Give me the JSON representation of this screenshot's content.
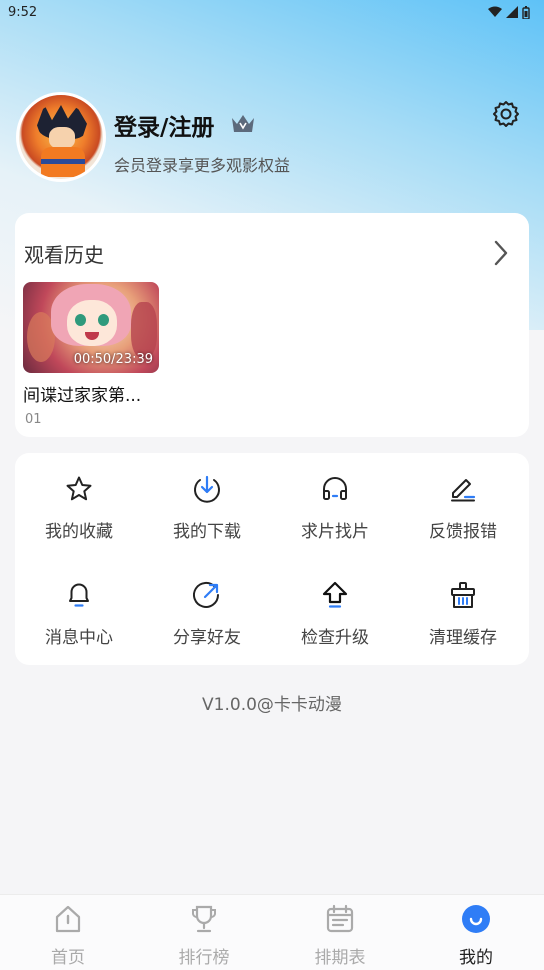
{
  "status_bar": {
    "time": "9:52"
  },
  "profile": {
    "login_label": "登录/注册",
    "subtitle": "会员登录享更多观影权益"
  },
  "history": {
    "title": "观看历史",
    "items": [
      {
        "title": "间谍过家家第...",
        "episode": "01",
        "progress_time": "00:50/23:39"
      }
    ]
  },
  "features": [
    {
      "label": "我的收藏",
      "icon": "star-icon"
    },
    {
      "label": "我的下载",
      "icon": "download-icon"
    },
    {
      "label": "求片找片",
      "icon": "headphones-icon"
    },
    {
      "label": "反馈报错",
      "icon": "edit-icon"
    },
    {
      "label": "消息中心",
      "icon": "bell-icon"
    },
    {
      "label": "分享好友",
      "icon": "share-icon"
    },
    {
      "label": "检查升级",
      "icon": "upgrade-icon"
    },
    {
      "label": "清理缓存",
      "icon": "clean-icon"
    }
  ],
  "version": "V1.0.0@卡卡动漫",
  "tabs": [
    {
      "label": "首页",
      "icon": "home-icon",
      "active": false
    },
    {
      "label": "排行榜",
      "icon": "trophy-icon",
      "active": false
    },
    {
      "label": "排期表",
      "icon": "calendar-icon",
      "active": false
    },
    {
      "label": "我的",
      "icon": "profile-icon",
      "active": true
    }
  ],
  "colors": {
    "accent": "#2f7df6",
    "header_gradient_top": "#5ec2f7"
  }
}
